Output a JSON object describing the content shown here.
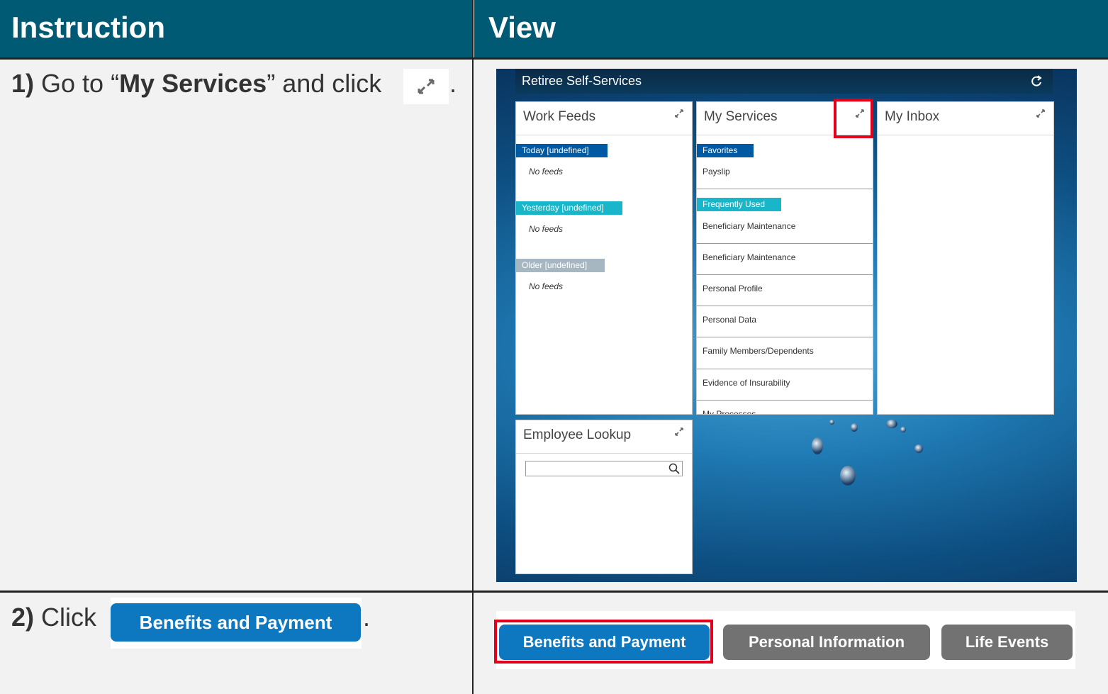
{
  "header": {
    "col1": "Instruction",
    "col2": "View"
  },
  "step1": {
    "number": "1)",
    "text_before": " Go to “",
    "target": "My Services",
    "text_after": "” and click",
    "period": ".",
    "expand_icon": "expand-icon"
  },
  "step2": {
    "number": "2)",
    "text": " Click",
    "button_label": "Benefits and Payment",
    "period": "."
  },
  "portal": {
    "title": "Retiree Self-Services",
    "refresh_icon": "refresh-icon",
    "panels": {
      "work_feeds": {
        "title": "Work Feeds",
        "groups": [
          {
            "label": "Today [undefined]",
            "empty": "No feeds",
            "color": "#005aa3"
          },
          {
            "label": "Yesterday [undefined]",
            "empty": "No feeds",
            "color": "#19b6c9"
          },
          {
            "label": "Older [undefined]",
            "empty": "No feeds",
            "color": "#a6b7c2"
          }
        ]
      },
      "my_services": {
        "title": "My Services",
        "favorites_label": "Favorites",
        "favorites": [
          "Payslip"
        ],
        "frequent_label": "Frequently Used",
        "frequent": [
          "Beneficiary Maintenance",
          "Beneficiary Maintenance",
          "Personal Profile",
          "Personal Data",
          "Family Members/Dependents",
          "Evidence of Insurability",
          "My Processes"
        ]
      },
      "my_inbox": {
        "title": "My Inbox"
      },
      "employee_lookup": {
        "title": "Employee Lookup",
        "search_value": ""
      }
    }
  },
  "tabs": [
    "Benefits and Payment",
    "Personal Information",
    "Life Events"
  ],
  "colors": {
    "header_bg": "#015a74",
    "button_blue": "#0d78bf",
    "button_gray": "#727272",
    "highlight_red": "#e2001a"
  }
}
